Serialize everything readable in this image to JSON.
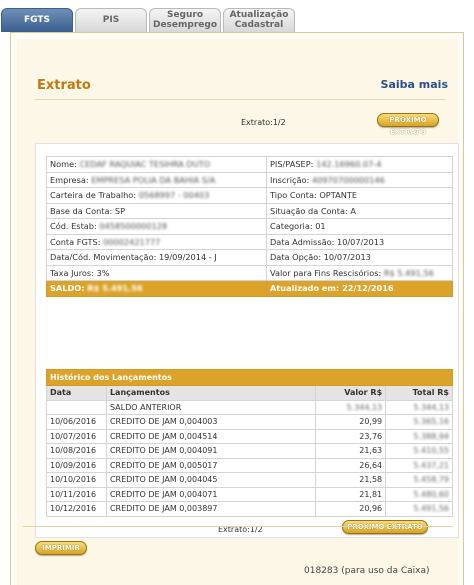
{
  "tabs": [
    {
      "line1": "FGTS",
      "line2": ""
    },
    {
      "line1": "PIS",
      "line2": ""
    },
    {
      "line1": "Seguro",
      "line2": "Desemprego"
    },
    {
      "line1": "Atualização",
      "line2": "Cadastral"
    }
  ],
  "header": {
    "title": "Extrato",
    "help_link": "Saiba mais"
  },
  "pagination": {
    "label": "Extrato:1/2",
    "next_button": "PRÓXIMO EXTRATO"
  },
  "info": {
    "nome": {
      "label": "Nome:",
      "value": "CEDAF RAQUIAC TESIHRA DUTO"
    },
    "pis": {
      "label": "PIS/PASEP:",
      "value": "142.16960.07-4"
    },
    "empresa": {
      "label": "Empresa:",
      "value": "EMPRESA POLIA DA BAHIA S/A"
    },
    "inscricao": {
      "label": "Inscrição:",
      "value": "40970700000146"
    },
    "carteira": {
      "label": "Carteira de Trabalho:",
      "value": "0568997 - 00403"
    },
    "tipo_conta": {
      "label": "Tipo Conta:",
      "value": "OPTANTE"
    },
    "base_conta": {
      "label": "Base da Conta:",
      "value": "SP"
    },
    "situacao": {
      "label": "Situação da Conta:",
      "value": "A"
    },
    "cod_estab": {
      "label": "Cód. Estab:",
      "value": "0458500000128"
    },
    "categoria": {
      "label": "Categoria:",
      "value": "01"
    },
    "conta_fgts": {
      "label": "Conta FGTS:",
      "value": "00002421777"
    },
    "data_admissao": {
      "label": "Data Admissão:",
      "value": "10/07/2013"
    },
    "data_mov": {
      "label": "Data/Cód. Movimentação:",
      "value": "19/09/2014 - J"
    },
    "data_opcao": {
      "label": "Data Opção:",
      "value": "10/07/2013"
    },
    "taxa_juros": {
      "label": "Taxa Juros:",
      "value": "3%"
    },
    "valor_fins": {
      "label": "Valor para Fins Rescisórios:",
      "value": "R$ 5.491,56"
    },
    "saldo": {
      "label": "SALDO:",
      "value": "R$ 5.491,56"
    },
    "atualizado": {
      "label": "Atualizado em:",
      "value": "22/12/2016"
    }
  },
  "history": {
    "title": "Histórico dos Lançamentos",
    "columns": [
      "Data",
      "Lançamentos",
      "Valor R$",
      "Total R$"
    ],
    "rows": [
      {
        "date": "",
        "desc": "SALDO ANTERIOR",
        "valor": "5.344,13",
        "total": "5.344,13",
        "valor_blur": true
      },
      {
        "date": "10/06/2016",
        "desc": "CREDITO DE JAM 0,004003",
        "valor": "20,99",
        "total": "5.365,16",
        "valor_blur": false
      },
      {
        "date": "10/07/2016",
        "desc": "CREDITO DE JAM 0,004514",
        "valor": "23,76",
        "total": "5.388,94",
        "valor_blur": false
      },
      {
        "date": "10/08/2016",
        "desc": "CREDITO DE JAM 0,004091",
        "valor": "21,63",
        "total": "5.410,55",
        "valor_blur": false
      },
      {
        "date": "10/09/2016",
        "desc": "CREDITO DE JAM 0,005017",
        "valor": "26,64",
        "total": "5.437,21",
        "valor_blur": false
      },
      {
        "date": "10/10/2016",
        "desc": "CREDITO DE JAM 0,004045",
        "valor": "21,58",
        "total": "5.458,79",
        "valor_blur": false
      },
      {
        "date": "10/11/2016",
        "desc": "CREDITO DE JAM 0,004071",
        "valor": "21,81",
        "total": "5.480,60",
        "valor_blur": false
      },
      {
        "date": "10/12/2016",
        "desc": "CREDITO DE JAM 0,003897",
        "valor": "20,96",
        "total": "5.491,56",
        "valor_blur": false
      }
    ]
  },
  "print_button": "IMPRIMIR",
  "footer": "018283 (para uso da Caixa)"
}
